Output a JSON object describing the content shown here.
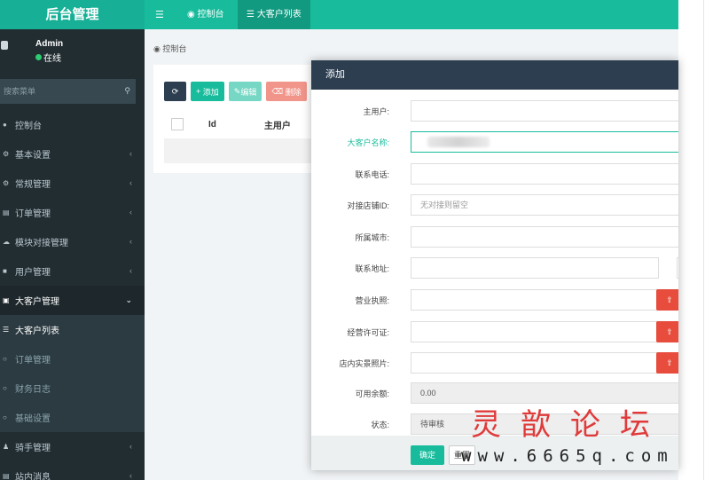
{
  "app": {
    "title": "后台管理"
  },
  "user": {
    "name": "Admin",
    "status": "在线"
  },
  "sidebar": {
    "search_placeholder": "搜索菜单",
    "items": [
      {
        "label": "控制台",
        "icon": "dashboard-icon"
      },
      {
        "label": "基本设置",
        "icon": "gear-icon"
      },
      {
        "label": "常规管理",
        "icon": "cogs-icon"
      },
      {
        "label": "订单管理",
        "icon": "list-icon"
      },
      {
        "label": "模块对接管理",
        "icon": "cloud-icon"
      },
      {
        "label": "用户管理",
        "icon": "user-icon"
      },
      {
        "label": "大客户管理",
        "icon": "id-card-icon"
      }
    ],
    "subitems": [
      {
        "label": "大客户列表",
        "icon": "list-icon"
      },
      {
        "label": "订单管理",
        "icon": "circle-icon"
      },
      {
        "label": "财务日志",
        "icon": "circle-icon"
      },
      {
        "label": "基础设置",
        "icon": "circle-icon"
      }
    ],
    "after": [
      {
        "label": "骑手管理",
        "icon": "rider-icon"
      },
      {
        "label": "站内消息",
        "icon": "message-icon"
      }
    ]
  },
  "topnav": {
    "tabs": [
      {
        "label": "控制台",
        "icon": "dashboard-icon"
      },
      {
        "label": "大客户列表",
        "icon": "list-icon"
      }
    ]
  },
  "breadcrumb": "控制台",
  "toolbar": {
    "add": "添加",
    "edit": "编辑",
    "delete": "删除"
  },
  "table": {
    "headers": [
      "Id",
      "主用户"
    ]
  },
  "modal": {
    "title": "添加",
    "fields": {
      "main_user": {
        "label": "主用户:",
        "value": ""
      },
      "customer_name": {
        "label": "大客户名称:",
        "value": ""
      },
      "phone": {
        "label": "联系电话:",
        "value": ""
      },
      "shop_id": {
        "label": "对接店铺ID:",
        "placeholder": "无对接则留空"
      },
      "city": {
        "label": "所属城市:",
        "value": ""
      },
      "address": {
        "label": "联系地址:",
        "value": ""
      },
      "license": {
        "label": "营业执照:",
        "value": ""
      },
      "permit": {
        "label": "经营许可证:",
        "value": ""
      },
      "photos": {
        "label": "店内实景照片:",
        "value": ""
      },
      "balance": {
        "label": "可用余额:",
        "value": "0.00"
      },
      "status": {
        "label": "状态:",
        "value": "待审核"
      }
    },
    "ok": "确定",
    "reset": "重置"
  },
  "watermark": {
    "cn": "灵歆论坛",
    "url": "www.6665q.com"
  },
  "colors": {
    "accent": "#18bc9c",
    "sidebar_bg": "#222d32",
    "modal_header": "#2c3e50",
    "danger": "#e74c3c"
  }
}
